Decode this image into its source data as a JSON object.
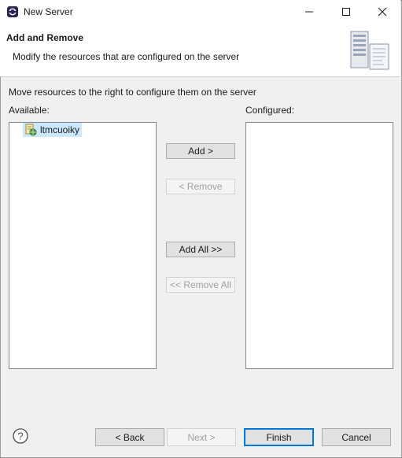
{
  "window": {
    "title": "New Server",
    "minimize_glyph": "—",
    "maximize_glyph": "☐",
    "close_glyph": "✕"
  },
  "header": {
    "title": "Add and Remove",
    "description": "Modify the resources that are configured on the server",
    "graphic_icon": "server-graphic-icon"
  },
  "main": {
    "instruction": "Move resources to the right to configure them on the server",
    "available_label": "Available:",
    "configured_label": "Configured:",
    "available_items": [
      {
        "label": "ltmcuoiky",
        "icon": "web-project-icon",
        "selected": true
      }
    ],
    "configured_items": []
  },
  "buttons": {
    "add": "Add >",
    "remove": "< Remove",
    "add_all": "Add All >>",
    "remove_all": "<< Remove All"
  },
  "footer": {
    "back": "< Back",
    "next": "Next >",
    "finish": "Finish",
    "cancel": "Cancel"
  },
  "colors": {
    "selection": "#cce8ff",
    "default_button_border": "#0078d7",
    "disabled_text": "#a0a0a0"
  }
}
